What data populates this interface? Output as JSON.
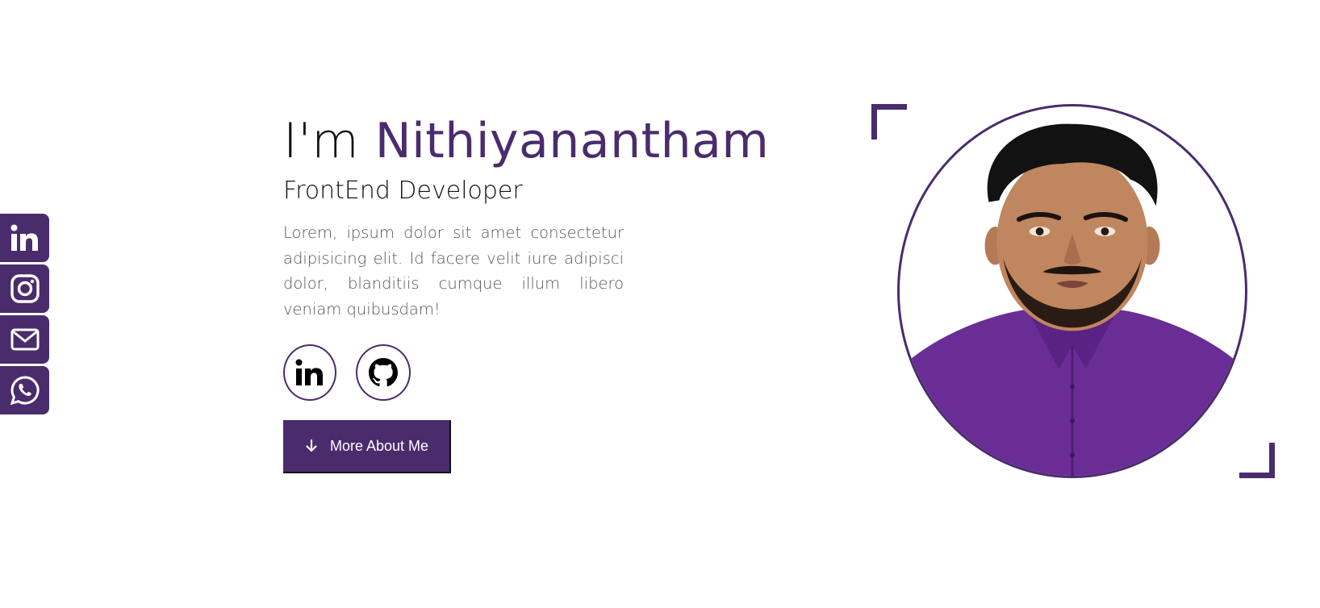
{
  "hero": {
    "greeting": "I'm",
    "name": "Nithiyanantham",
    "role": "FrontEnd Developer",
    "description": "Lorem, ipsum dolor sit amet consectetur adipisicing elit. Id facere velit iure adipisci dolor, blanditiis cumque illum libero veniam quibusdam!",
    "cta_label": "More About Me"
  },
  "side_social": [
    {
      "icon": "linkedin-icon"
    },
    {
      "icon": "instagram-icon"
    },
    {
      "icon": "mail-icon"
    },
    {
      "icon": "whatsapp-icon"
    }
  ],
  "circle_social": [
    {
      "icon": "linkedin-icon"
    },
    {
      "icon": "github-icon"
    }
  ],
  "colors": {
    "accent": "#4a2c6d",
    "text": "#111111",
    "muted": "#555555",
    "background": "#ffffff"
  }
}
